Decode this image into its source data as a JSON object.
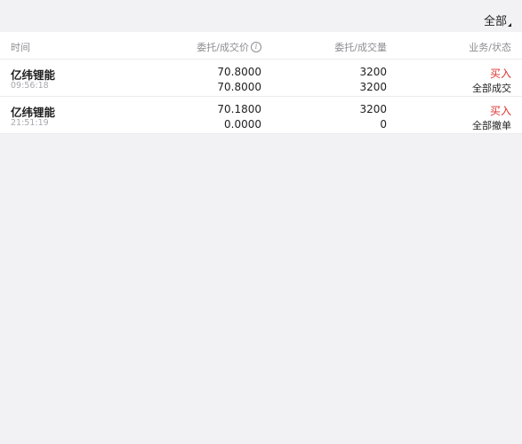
{
  "filter": {
    "label": "全部"
  },
  "header": {
    "time": "时间",
    "price": "委托/成交价",
    "qty": "委托/成交量",
    "status": "业务/状态",
    "info_icon": "i"
  },
  "rows": [
    {
      "name": "亿纬锂能",
      "time": "09:56:18",
      "order_price": "70.8000",
      "deal_price": "70.8000",
      "order_qty": "3200",
      "deal_qty": "3200",
      "side": "买入",
      "status": "全部成交"
    },
    {
      "name": "亿纬锂能",
      "time": "21:51:19",
      "order_price": "70.1800",
      "deal_price": "0.0000",
      "order_qty": "3200",
      "deal_qty": "0",
      "side": "买入",
      "status": "全部撤单"
    }
  ],
  "colors": {
    "buy": "#e0312f",
    "background": "#f2f2f5"
  }
}
